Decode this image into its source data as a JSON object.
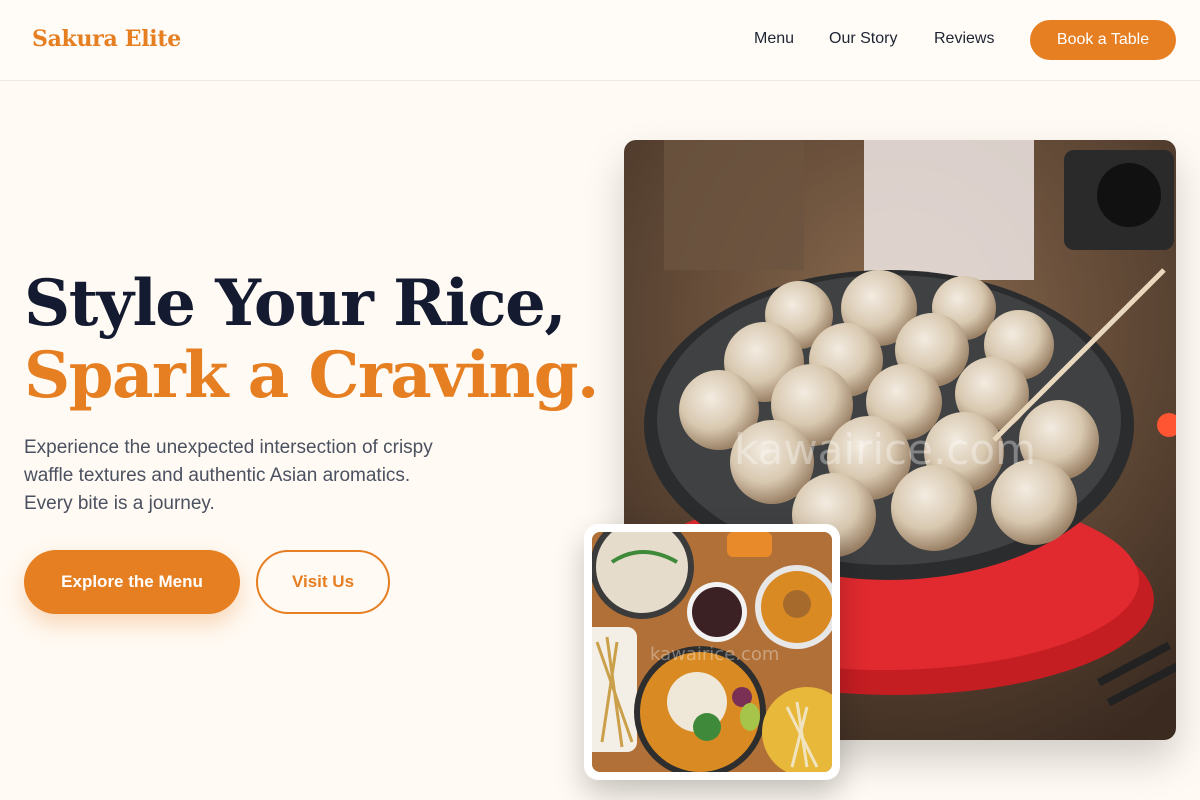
{
  "header": {
    "brand": "Sakura Elite",
    "nav": [
      {
        "label": "Menu"
      },
      {
        "label": "Our Story"
      },
      {
        "label": "Reviews"
      }
    ],
    "cta_label": "Book a Table"
  },
  "hero": {
    "headline_line1": "Style Your Rice,",
    "headline_line2": "Spark a Craving.",
    "subtext": "Experience the unexpected intersection of crispy waffle textures and authentic Asian aromatics. Every bite is a journey.",
    "primary_button": "Explore the Menu",
    "secondary_button": "Visit Us"
  },
  "images": {
    "main_watermark": "kawairice.com",
    "inset_watermark": "kawairice.com"
  },
  "colors": {
    "accent": "#e67e22",
    "headline_dark": "#141a30",
    "background": "#fffaf3"
  }
}
